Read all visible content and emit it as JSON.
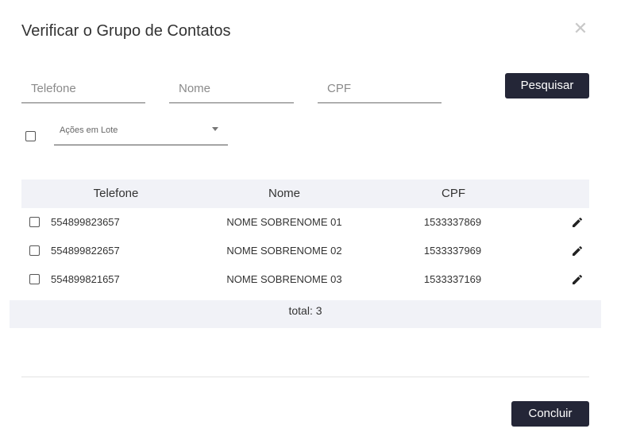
{
  "modal": {
    "title": "Verificar o Grupo de Contatos",
    "close_glyph": "✕"
  },
  "filters": {
    "telefone_placeholder": "Telefone",
    "nome_placeholder": "Nome",
    "cpf_placeholder": "CPF",
    "search_label": "Pesquisar"
  },
  "batch": {
    "label": "Ações em Lote"
  },
  "table": {
    "headers": {
      "telefone": "Telefone",
      "nome": "Nome",
      "cpf": "CPF"
    },
    "rows": [
      {
        "telefone": "554899823657",
        "nome": "NOME SOBRENOME 01",
        "cpf": "1533337869"
      },
      {
        "telefone": "554899822657",
        "nome": "NOME SOBRENOME 02",
        "cpf": "1533337969"
      },
      {
        "telefone": "554899821657",
        "nome": "NOME SOBRENOME 03",
        "cpf": "1533337169"
      }
    ],
    "total_label": "total: 3"
  },
  "footer": {
    "done_label": "Concluir"
  },
  "colors": {
    "primary_button": "#242637",
    "table_header_bg": "#f1f2f7"
  },
  "icons": {
    "close": "close-icon",
    "edit": "pencil-icon",
    "dropdown": "caret-down-icon"
  }
}
